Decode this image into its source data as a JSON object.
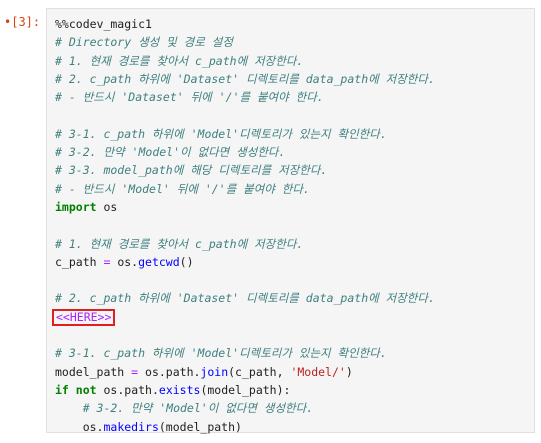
{
  "cell": {
    "prompt": "[3]:",
    "prompt_dot": "•",
    "lines": [
      {
        "type": "plain",
        "text": "%%codev_magic1"
      },
      {
        "type": "comment",
        "text": "# Directory 생성 및 경로 설정"
      },
      {
        "type": "comment",
        "text": "# 1. 현재 경로를 찾아서 c_path에 저장한다."
      },
      {
        "type": "comment",
        "text": "# 2. c_path 하위에 'Dataset' 디렉토리를 data_path에 저장한다."
      },
      {
        "type": "comment",
        "text": "# - 반드시 'Dataset' 뒤에 '/'를 붙여야 한다."
      },
      {
        "type": "blank",
        "text": ""
      },
      {
        "type": "comment",
        "text": "# 3-1. c_path 하위에 'Model'디렉토리가 있는지 확인한다."
      },
      {
        "type": "comment",
        "text": "# 3-2. 만약 'Model'이 없다면 생성한다."
      },
      {
        "type": "comment",
        "text": "# 3-3. model_path에 해당 디렉토리를 저장한다."
      },
      {
        "type": "comment",
        "text": "# - 반드시 'Model' 뒤에 '/'를 붙여야 한다."
      },
      {
        "type": "import",
        "kw": "import",
        "text": " os"
      },
      {
        "type": "blank",
        "text": ""
      },
      {
        "type": "comment",
        "text": "# 1. 현재 경로를 찾아서 c_path에 저장한다."
      },
      {
        "type": "getcwd",
        "a": "c_path ",
        "op": "=",
        "b": " os.",
        "fn": "getcwd",
        "c": "()"
      },
      {
        "type": "blank",
        "text": ""
      },
      {
        "type": "comment",
        "text": "# 2. c_path 하위에 'Dataset' 디렉토리를 data_path에 저장한다."
      },
      {
        "type": "here",
        "text": "<<HERE>>"
      },
      {
        "type": "blank",
        "text": ""
      },
      {
        "type": "comment",
        "text": "# 3-1. c_path 하위에 'Model'디렉토리가 있는지 확인한다."
      },
      {
        "type": "join",
        "a": "model_path ",
        "op": "=",
        "b": " os.path.",
        "fn": "join",
        "c": "(c_path, ",
        "str": "'Model/'",
        "d": ")"
      },
      {
        "type": "ifnot",
        "kw1": "if",
        "kw2": "not",
        "a": " os.path.",
        "fn": "exists",
        "b": "(model_path):"
      },
      {
        "type": "comment_indent",
        "text": "    # 3-2. 만약 'Model'이 없다면 생성한다."
      },
      {
        "type": "makedirs",
        "indent": "    ",
        "a": "os.",
        "fn": "makedirs",
        "b": "(model_path)"
      }
    ]
  }
}
